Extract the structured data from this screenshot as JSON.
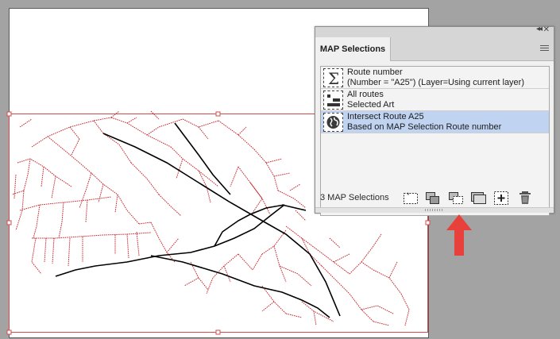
{
  "panel": {
    "title": "MAP Selections",
    "collapse_icon": "double-chevron-left",
    "close_icon": "close-x",
    "menu_icon": "hamburger",
    "count_label": "3 MAP Selections",
    "selections": [
      {
        "line1": "Route number",
        "line2": "(Number = \"A25\") (Layer=Using current layer)",
        "icon": "sigma-icon",
        "selected": false
      },
      {
        "line1": "All routes",
        "line2": "Selected Art",
        "icon": "layers-selection-icon",
        "selected": false
      },
      {
        "line1": "Intersect Route A25",
        "line2": "Based on MAP Selection Route number",
        "icon": "globe-icon",
        "selected": true
      }
    ],
    "toolbar": [
      {
        "icon": "new-selection-icon"
      },
      {
        "icon": "intersect-selection-icon"
      },
      {
        "icon": "based-on-selection-icon"
      },
      {
        "icon": "stack-selection-icon"
      },
      {
        "icon": "add-selection-icon"
      },
      {
        "icon": "trash-icon"
      }
    ]
  },
  "colors": {
    "road_red": "#c8282f",
    "road_black": "#000000",
    "selection_box": "#d34a4a",
    "selected_row": "#c0d4f2",
    "arrow": "#e8403a"
  }
}
